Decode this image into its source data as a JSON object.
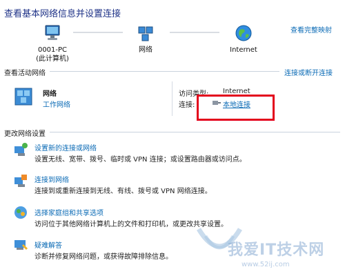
{
  "header": {
    "title": "查看基本网络信息并设置连接",
    "full_map_link": "查看完整映射"
  },
  "network_map": {
    "nodes": [
      {
        "label_line1": "0001-PC",
        "label_line2": "(此计算机)",
        "icon": "computer-icon"
      },
      {
        "label_line1": "网络",
        "icon": "network-icon"
      },
      {
        "label_line1": "Internet",
        "icon": "globe-icon"
      }
    ]
  },
  "active_networks": {
    "section_title": "查看活动网络",
    "connect_disconnect_link": "连接或断开连接",
    "network_name": "网络",
    "network_type": "工作网络",
    "access_type_label": "访问类型:",
    "access_type_value": "Internet",
    "connection_label": "连接:",
    "connection_value": "本地连接"
  },
  "settings": {
    "section_title": "更改网络设置",
    "tasks": [
      {
        "title": "设置新的连接或网络",
        "desc": "设置无线、宽带、拨号、临时或 VPN 连接；或设置路由器或访问点。",
        "icon": "setup-connection-icon"
      },
      {
        "title": "连接到网络",
        "desc": "连接到或重新连接到无线、有线、拨号或 VPN 网络连接。",
        "icon": "connect-network-icon"
      },
      {
        "title": "选择家庭组和共享选项",
        "desc": "访问位于其他网络计算机上的文件和打印机，或更改共享设置。",
        "icon": "homegroup-icon"
      },
      {
        "title": "疑难解答",
        "desc": "诊断并修复网络问题，或获得故障排除信息。",
        "icon": "troubleshoot-icon"
      }
    ]
  },
  "watermark": {
    "text": "我爱IT技术网",
    "url": "www.52ij.com"
  },
  "colors": {
    "link": "#0a6ab5",
    "title": "#1e3287",
    "highlight_box": "#e3001b"
  }
}
